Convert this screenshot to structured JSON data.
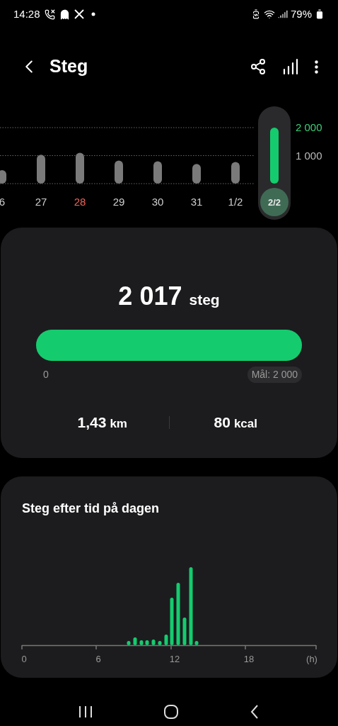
{
  "status_bar": {
    "time": "14:28",
    "battery": "79%"
  },
  "header": {
    "title": "Steg"
  },
  "daily_chart": {
    "chart_data": {
      "type": "bar",
      "categories": [
        "6",
        "27",
        "28",
        "29",
        "30",
        "31",
        "1/2",
        "2/2"
      ],
      "series": [
        {
          "color": "#7a7a7a",
          "values": [
            480,
            1030,
            1100,
            820,
            800,
            700,
            770,
            null
          ]
        },
        {
          "color": "#14cc6e",
          "values": [
            null,
            null,
            null,
            null,
            null,
            null,
            null,
            2000
          ]
        }
      ],
      "ylim": [
        0,
        2000
      ],
      "yticks": [
        {
          "value": 1000,
          "label": "1 000"
        },
        {
          "value": 2000,
          "label": "2 000"
        }
      ]
    },
    "days": [
      {
        "selected": false
      },
      {
        "selected": false
      },
      {
        "selected": false,
        "color": "#f0645a"
      },
      {
        "selected": false
      },
      {
        "selected": false
      },
      {
        "selected": false
      },
      {
        "selected": false
      },
      {
        "selected": true
      }
    ]
  },
  "summary": {
    "steps": "2 017",
    "steps_unit": "steg",
    "level": 1,
    "min_label": "0",
    "goal": "Mål: 2 000",
    "stats": [
      {
        "value": "1,43",
        "unit": "km"
      },
      {
        "value": "80",
        "unit": "kcal"
      }
    ]
  },
  "hourly": {
    "title": "Steg efter tid på dagen",
    "axis_labels": [
      "0",
      "6",
      "12",
      "18",
      "(h)"
    ]
  }
}
